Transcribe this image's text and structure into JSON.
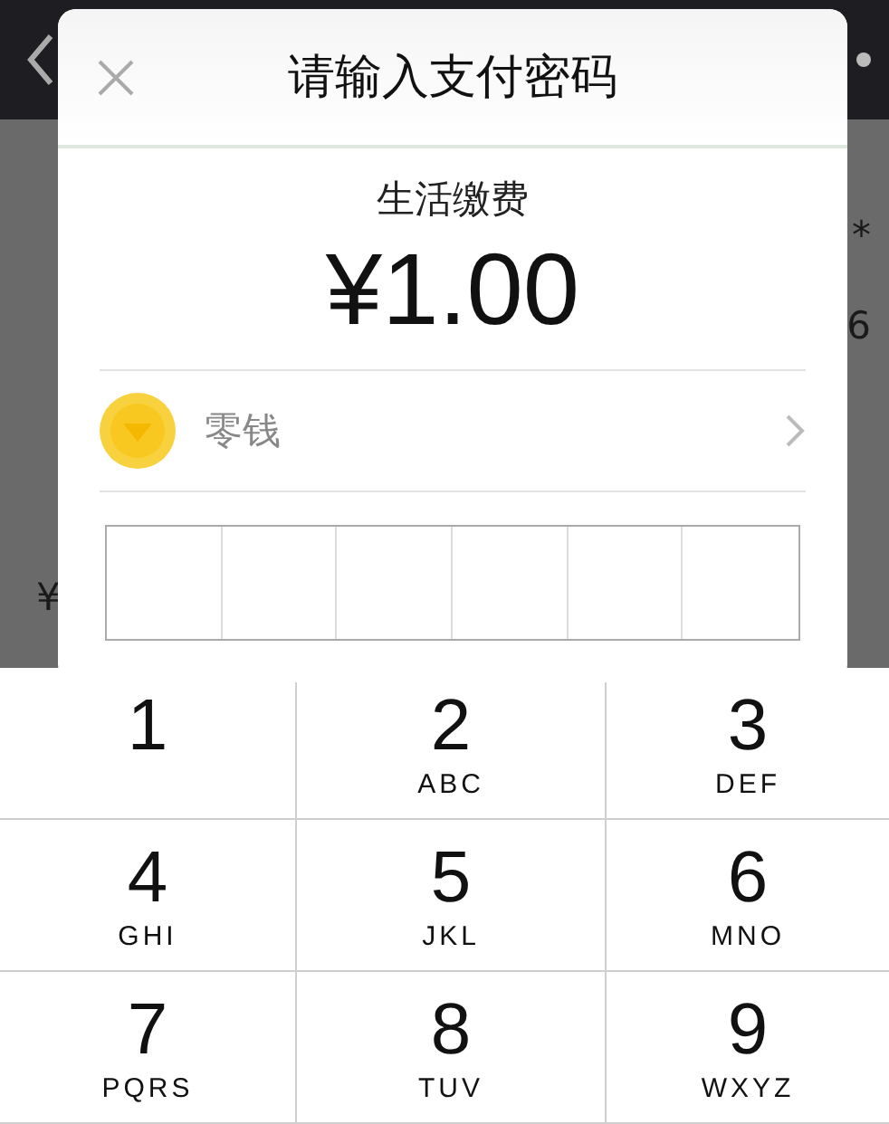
{
  "background_values": [
    "*",
    "6"
  ],
  "background_amount": "¥",
  "dialog": {
    "title": "请输入支付密码",
    "merchant": "生活缴费",
    "amount": "¥1.00",
    "payment_method": {
      "label": "零钱"
    },
    "password_cells": [
      {
        "filled": false
      },
      {
        "filled": false
      },
      {
        "filled": false
      },
      {
        "filled": false
      },
      {
        "filled": false
      },
      {
        "filled": false
      }
    ]
  },
  "keypad": [
    {
      "digit": "1"
    },
    {
      "digit": "2",
      "letters": "ABC"
    },
    {
      "digit": "3",
      "letters": "DEF"
    },
    {
      "digit": "4",
      "letters": "GHI"
    },
    {
      "digit": "5",
      "letters": "JKL"
    },
    {
      "digit": "6",
      "letters": "MNO"
    },
    {
      "digit": "7",
      "letters": "PQRS"
    },
    {
      "digit": "8",
      "letters": "TUV"
    },
    {
      "digit": "9",
      "letters": "WXYZ"
    }
  ]
}
